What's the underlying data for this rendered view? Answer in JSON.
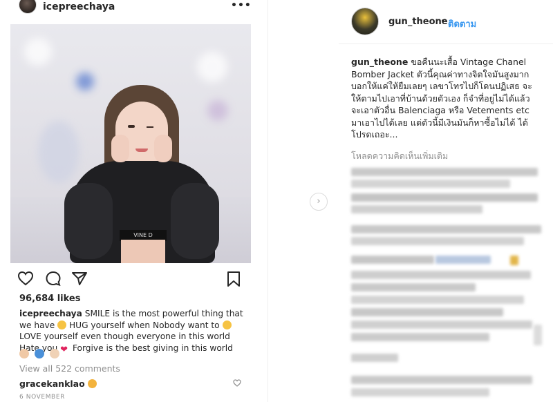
{
  "left_post": {
    "username": "icepreechaya",
    "more_label": "•••",
    "photo_text": "VINE D",
    "likes": "96,684 likes",
    "caption_user": "icepreechaya",
    "caption_line1": "SMILE is the most powerful thing that",
    "caption_line2a": "we have",
    "caption_line2b": "HUG yourself when Nobody want to",
    "caption_line3": "LOVE yourself even though everyone in this world",
    "caption_line4a": "Hate you",
    "caption_line4b": "Forgive is the best giving in this world",
    "view_all": "View all 522 comments",
    "comment_user": "gracekankla​o",
    "date": "6 NOVEMBER"
  },
  "right_panel": {
    "username": "gun_theone",
    "separator": "•",
    "follow_label": "ติดตาม",
    "caption_user": "gun_theone",
    "caption_text": "ขอคืนนะเสื้อ Vintage Chanel Bomber Jacket ตัวนี้คุณค่าทางจิตใจมันสูงมาก บอกให้แค่ให้ยืมเลยๆ เลขาโทรไปก็โดนปฏิเสธ จะให้ตามไปเอาที่บ้านด้วยตัวเอง ก็จำที่อยู่ไม่ได้แล้ว จะเอาตัวอื่น Balenciaga หรือ Vetements etc มาเอาไปได้เลย แต่ตัวนี้มีเงินมันก็หาซื้อไม่ได้ ได้โปรดเถอะ...",
    "load_more": "โหลดความคิดเห็นเพิ่มเติม"
  },
  "next_arrow": "›",
  "colors": {
    "text": "#262626",
    "muted": "#8e8e8e",
    "link": "#3897f0",
    "like_heart": "#e0245e"
  }
}
